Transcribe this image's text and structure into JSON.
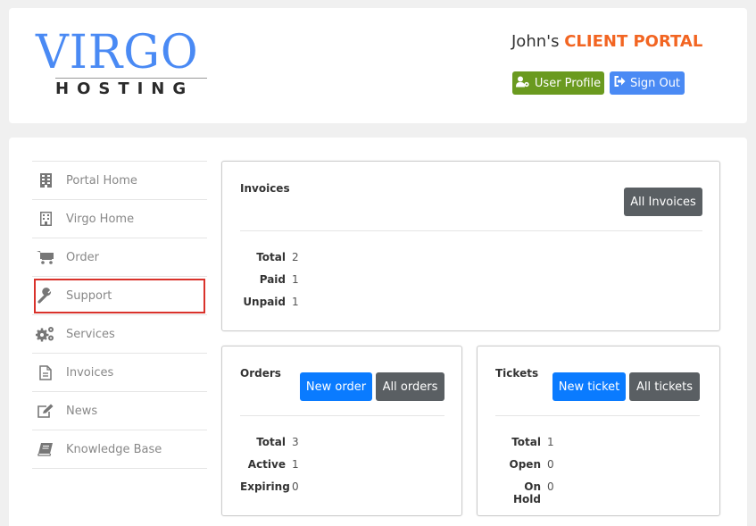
{
  "header": {
    "logo_main": "VIRGO",
    "logo_sub": "HOSTING",
    "title_prefix": "John's",
    "title_accent": "CLIENT PORTAL",
    "user_profile_label": "User Profile",
    "sign_out_label": "Sign Out"
  },
  "colors": {
    "brand_blue": "#4a8af4",
    "accent_orange": "#f26522",
    "profile_green": "#6a9a1f",
    "primary_button": "#0a7bff",
    "secondary_button": "#5a5f63",
    "highlight_red": "#d9322b"
  },
  "sidebar": {
    "items": [
      {
        "label": "Portal Home",
        "icon": "building-icon"
      },
      {
        "label": "Virgo Home",
        "icon": "building-outline-icon"
      },
      {
        "label": "Order",
        "icon": "cart-icon"
      },
      {
        "label": "Support",
        "icon": "wrench-icon",
        "highlighted": true
      },
      {
        "label": "Services",
        "icon": "gears-icon"
      },
      {
        "label": "Invoices",
        "icon": "document-icon"
      },
      {
        "label": "News",
        "icon": "edit-icon"
      },
      {
        "label": "Knowledge Base",
        "icon": "book-icon"
      }
    ]
  },
  "invoices": {
    "title": "Invoices",
    "all_label": "All Invoices",
    "stats": [
      {
        "label": "Total",
        "value": "2"
      },
      {
        "label": "Paid",
        "value": "1"
      },
      {
        "label": "Unpaid",
        "value": "1"
      }
    ]
  },
  "orders": {
    "title": "Orders",
    "new_label": "New order",
    "all_label": "All orders",
    "stats": [
      {
        "label": "Total",
        "value": "3"
      },
      {
        "label": "Active",
        "value": "1"
      },
      {
        "label": "Expiring",
        "value": "0"
      }
    ]
  },
  "tickets": {
    "title": "Tickets",
    "new_label": "New ticket",
    "all_label": "All tickets",
    "stats": [
      {
        "label": "Total",
        "value": "1"
      },
      {
        "label": "Open",
        "value": "0"
      },
      {
        "label": "On Hold",
        "value": "0"
      }
    ]
  }
}
